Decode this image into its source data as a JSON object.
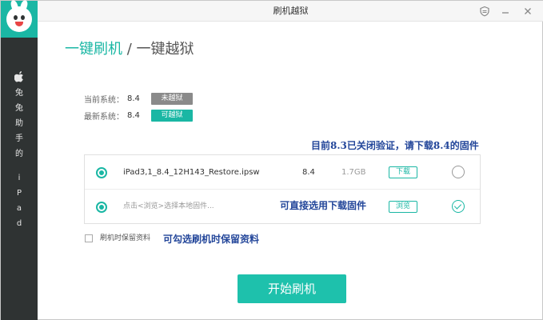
{
  "sidebar": {
    "brand_chars": [
      "兔",
      "兔",
      "助",
      "手",
      "的",
      "i",
      "P",
      "a",
      "d"
    ]
  },
  "window": {
    "title": "刷机越狱"
  },
  "tabs": {
    "active": "一键刷机",
    "separator": "/",
    "inactive": "一键越狱"
  },
  "system": {
    "current_label": "当前系统：",
    "current_version": "8.4",
    "current_status": "未越狱",
    "latest_label": "最新系统：",
    "latest_version": "8.4",
    "latest_status": "可越狱"
  },
  "annotations": {
    "verify_closed": "目前8.3已关闭验证，请下载8.4的固件",
    "choose_download": "可直接选用下载固件",
    "keep_data": "可勾选刷机时保留资料"
  },
  "firmware": {
    "row1": {
      "name": "iPad3,1_8.4_12H143_Restore.ipsw",
      "version": "8.4",
      "size": "1.7GB",
      "button": "下载"
    },
    "row2": {
      "placeholder": "点击<浏览>选择本地固件...",
      "button": "浏览"
    }
  },
  "options": {
    "keep_data_label": "刷机时保留资料"
  },
  "actions": {
    "start_label": "开始刷机"
  },
  "colors": {
    "accent": "#1ab7a4",
    "sidebar": "#2f3333",
    "annotation": "#23469a"
  }
}
